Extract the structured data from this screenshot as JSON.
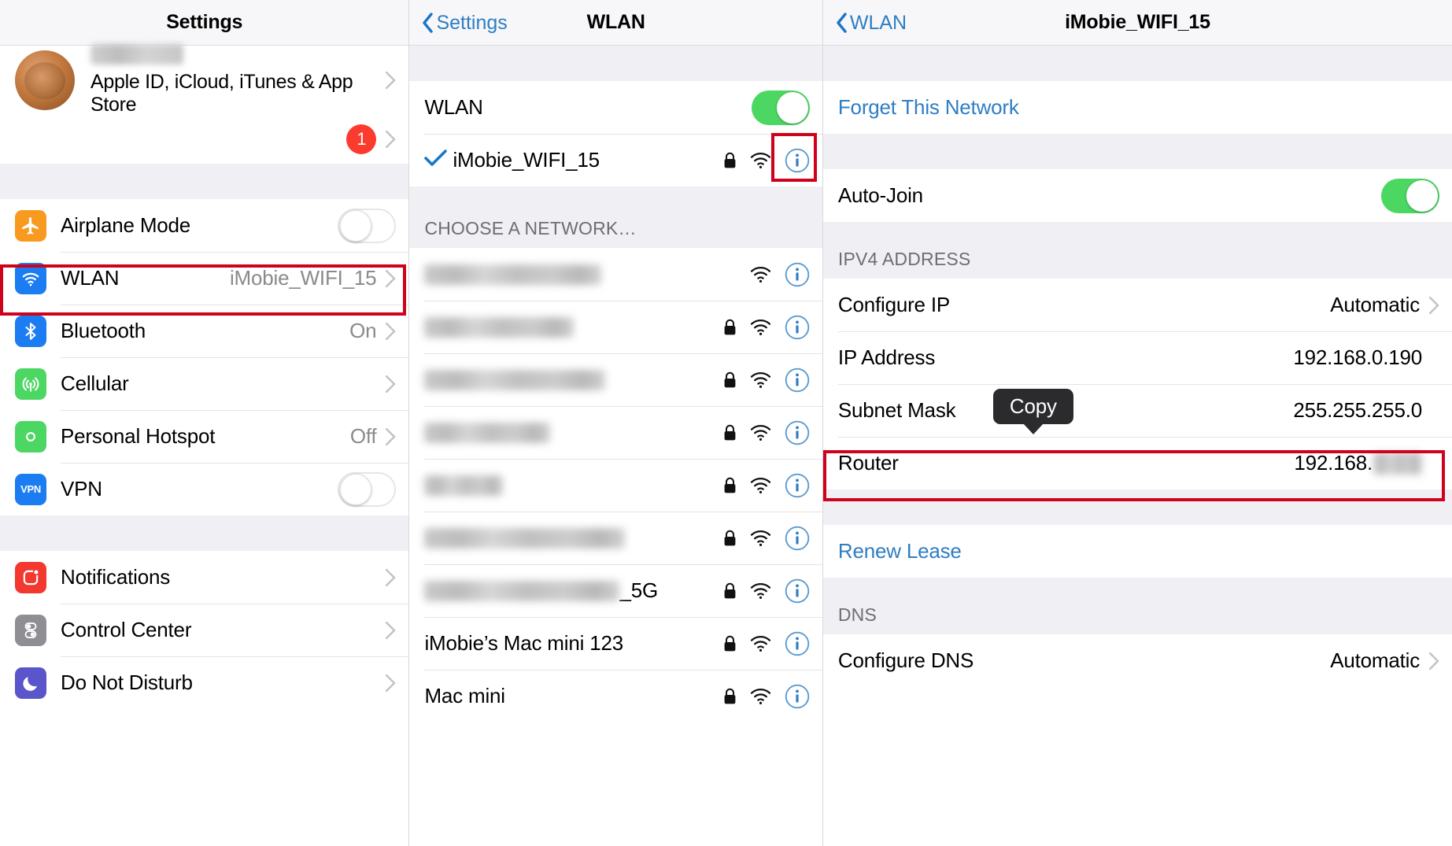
{
  "settings_panel": {
    "title": "Settings",
    "account": {
      "name_blurred": "",
      "subtitle": "Apple ID, iCloud, iTunes & App Store",
      "badge": "1"
    },
    "groups": [
      {
        "items": [
          {
            "label": "Airplane Mode",
            "icon": "airplane-icon",
            "color": "#f99a20",
            "control": "toggle-off"
          },
          {
            "label": "WLAN",
            "icon": "wifi-icon",
            "color": "#1c7cf2",
            "value": "iMobie_WIFI_15",
            "control": "chevron",
            "highlighted": true
          },
          {
            "label": "Bluetooth",
            "icon": "bluetooth-icon",
            "color": "#1c7cf2",
            "value": "On",
            "control": "chevron"
          },
          {
            "label": "Cellular",
            "icon": "cellular-icon",
            "color": "#4cd763",
            "value": "",
            "control": "chevron"
          },
          {
            "label": "Personal Hotspot",
            "icon": "hotspot-icon",
            "color": "#4cd763",
            "value": "Off",
            "control": "chevron"
          },
          {
            "label": "VPN",
            "icon": "vpn-icon",
            "color": "#1c7cf2",
            "control": "toggle-off"
          }
        ]
      },
      {
        "items": [
          {
            "label": "Notifications",
            "icon": "notifications-icon",
            "color": "#f3392f",
            "control": "chevron"
          },
          {
            "label": "Control Center",
            "icon": "control-center-icon",
            "color": "#8e8e93",
            "control": "chevron"
          },
          {
            "label": "Do Not Disturb",
            "icon": "moon-icon",
            "color": "#5a55ca",
            "control": "chevron"
          }
        ]
      }
    ]
  },
  "wlan_panel": {
    "back_label": "Settings",
    "title": "WLAN",
    "wlan_toggle_label": "WLAN",
    "wlan_toggle_state": "on",
    "connected_network": {
      "name": "iMobie_WIFI_15",
      "checked": true,
      "secured": true,
      "info_highlighted": true
    },
    "choose_header": "CHOOSE A NETWORK…",
    "networks": [
      {
        "name": "",
        "blurred": true,
        "blur_width": 225,
        "secured": false
      },
      {
        "name": "",
        "blurred": true,
        "blur_width": 190,
        "secured": true
      },
      {
        "name": "",
        "blurred": true,
        "blur_width": 230,
        "secured": true
      },
      {
        "name": "",
        "blurred": true,
        "blur_width": 160,
        "secured": true
      },
      {
        "name": "",
        "blurred": true,
        "blur_width": 100,
        "secured": true
      },
      {
        "name": "",
        "blurred": true,
        "blur_width": 255,
        "secured": true
      },
      {
        "name": "_5G",
        "blurred": true,
        "blur_width": 248,
        "secured": true
      },
      {
        "name": "iMobie’s Mac mini 123",
        "blurred": false,
        "secured": true
      },
      {
        "name": "Mac mini",
        "blurred": false,
        "secured": true
      }
    ]
  },
  "detail_panel": {
    "back_label": "WLAN",
    "title": "iMobie_WIFI_15",
    "forget_label": "Forget This Network",
    "auto_join_label": "Auto-Join",
    "auto_join_state": "on",
    "ipv4_header": "IPV4 ADDRESS",
    "ipv4_rows": [
      {
        "label": "Configure IP",
        "value": "Automatic",
        "chevron": true
      },
      {
        "label": "IP Address",
        "value": "192.168.0.190",
        "chevron": false
      },
      {
        "label": "Subnet Mask",
        "value": "255.255.255.0",
        "chevron": false
      },
      {
        "label": "Router",
        "value": "192.168.",
        "value_blurred": true,
        "chevron": false,
        "highlighted": true
      }
    ],
    "renew_lease_label": "Renew Lease",
    "dns_header": "DNS",
    "dns_rows": [
      {
        "label": "Configure DNS",
        "value": "Automatic",
        "chevron": true
      }
    ],
    "copy_tooltip": "Copy"
  }
}
